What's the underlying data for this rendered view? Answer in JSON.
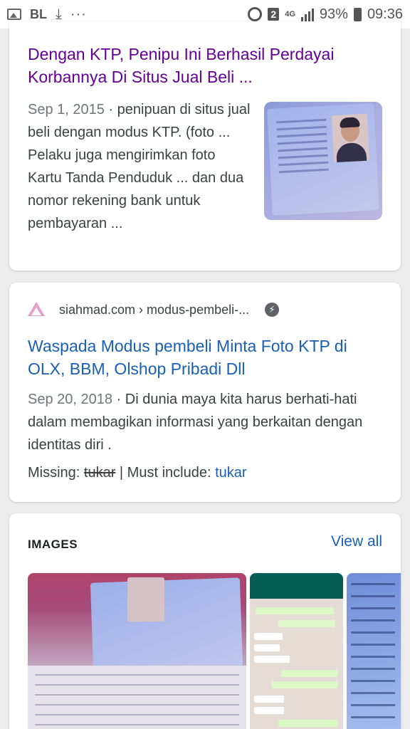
{
  "status_bar": {
    "left_text": "BL",
    "notification_count": "2",
    "network": "4G",
    "battery": "93%",
    "time": "09:36",
    "icons": [
      "image-icon",
      "download-icon",
      "more-icon",
      "alarm-icon",
      "signal-icon",
      "battery-icon"
    ]
  },
  "result1": {
    "title": "Dengan KTP, Penipu Ini Berhasil Perdayai Korbannya Di Situs Jual Beli ...",
    "date": "Sep 1, 2015",
    "separator": " · ",
    "snippet": "penipuan di situs jual beli dengan modus KTP. (foto ... Pelaku juga mengirimkan foto Kartu Tanda Penduduk ... dan dua nomor rekening bank untuk pembayaran ..."
  },
  "result2": {
    "site": "siahmad.com › modus-pembeli-...",
    "title": "Waspada Modus pembeli Minta Foto KTP di OLX, BBM, Olshop Pribadi Dll",
    "date": "Sep 20, 2018",
    "separator": " · ",
    "snippet": "Di dunia maya kita harus berhati-hati dalam membagikan informasi yang berkaitan dengan identitas diri .",
    "missing_label": "Missing: ",
    "missing_word": "tukar",
    "must_include_label": " | Must include: ",
    "must_include_word": "tukar"
  },
  "images": {
    "heading": "IMAGES",
    "view_all": "View all"
  },
  "colors": {
    "visited_link": "#660099",
    "link": "#1a5fb4",
    "text": "#3c4043",
    "meta": "#70757a"
  }
}
